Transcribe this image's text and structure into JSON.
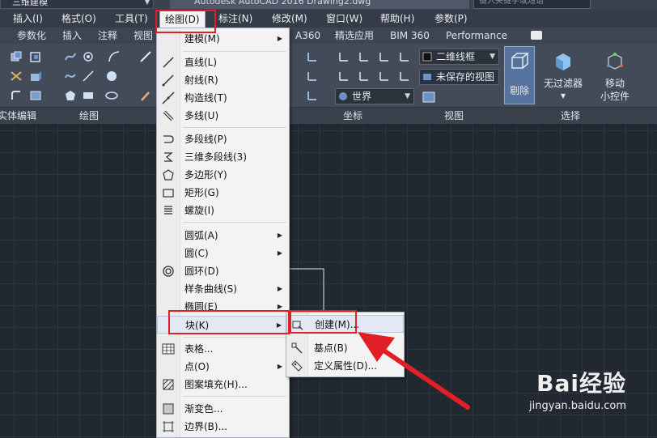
{
  "titlebar": {
    "workspace": "三维建模",
    "app_title": "Autodesk AutoCAD 2016    Drawing2.dwg",
    "search_placeholder": "键入关键字或短语"
  },
  "menubar": {
    "items": [
      {
        "label": "插入(I)"
      },
      {
        "label": "格式(O)"
      },
      {
        "label": "工具(T)"
      },
      {
        "label": "绘图(D)"
      },
      {
        "label": "标注(N)"
      },
      {
        "label": "修改(M)"
      },
      {
        "label": "窗口(W)"
      },
      {
        "label": "帮助(H)"
      },
      {
        "label": "参数(P)"
      }
    ]
  },
  "ribbon_tabs": [
    {
      "label": "参数化"
    },
    {
      "label": "插入"
    },
    {
      "label": "注释"
    },
    {
      "label": "视图"
    },
    {
      "label": "A360"
    },
    {
      "label": "精选应用"
    },
    {
      "label": "BIM 360"
    },
    {
      "label": "Performance"
    }
  ],
  "ribbon": {
    "visual_style": "二维线框",
    "saved_view": "未保存的视图",
    "ucs": "世界",
    "cull_button": "剔除",
    "no_filter_button": "无过滤器",
    "move_gizmo_line1": "移动",
    "move_gizmo_line2": "小控件"
  },
  "panel_labels": [
    {
      "label": "实体编辑"
    },
    {
      "label": "绘图"
    },
    {
      "label": "坐标"
    },
    {
      "label": "视图"
    },
    {
      "label": "选择"
    }
  ],
  "draw_menu": {
    "items": {
      "modeling": "建模(M)",
      "line": "直线(L)",
      "ray": "射线(R)",
      "xline": "构造线(T)",
      "mline": "多线(U)",
      "pline": "多段线(P)",
      "3dpoly": "三维多段线(3)",
      "polygon": "多边形(Y)",
      "rectangle": "矩形(G)",
      "helix": "螺旋(I)",
      "arc": "圆弧(A)",
      "circle": "圆(C)",
      "donut": "圆环(D)",
      "spline": "样条曲线(S)",
      "ellipse": "椭圆(E)",
      "block": "块(K)",
      "table": "表格...",
      "point": "点(O)",
      "hatch": "图案填充(H)...",
      "gradient": "渐变色...",
      "boundary": "边界(B)..."
    }
  },
  "block_submenu": {
    "create": "创建(M)...",
    "base": "基点(B)",
    "attdef": "定义属性(D)..."
  },
  "watermark": {
    "brand": "Bai经验",
    "url": "jingyan.baidu.com"
  },
  "colors": {
    "annotation_red": "#e21f26",
    "canvas_bg": "#212830",
    "menu_bg": "#f3f3f3",
    "ribbon_bg": "#434b58"
  }
}
